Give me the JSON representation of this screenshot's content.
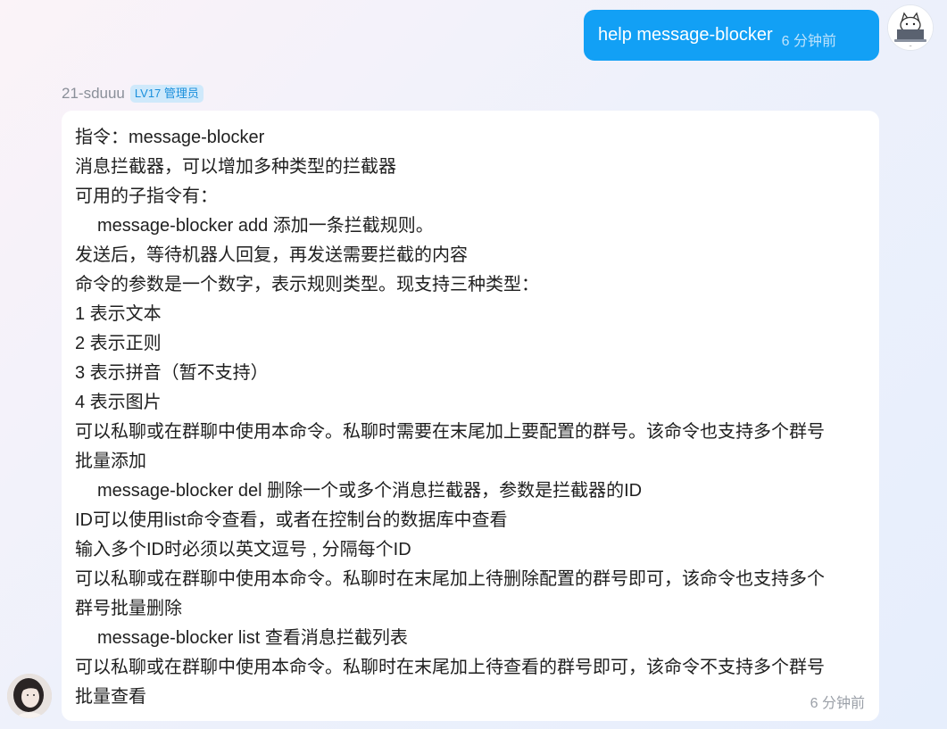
{
  "outgoing": {
    "text": "help message-blocker",
    "time": "6 分钟前"
  },
  "incoming": {
    "sender": "21-sduuu",
    "badge": "LV17 管理员",
    "time": "6 分钟前",
    "lines": [
      {
        "text": "指令：message-blocker",
        "indent": false
      },
      {
        "text": "消息拦截器，可以增加多种类型的拦截器",
        "indent": false
      },
      {
        "text": "可用的子指令有：",
        "indent": false
      },
      {
        "text": "message-blocker add  添加一条拦截规则。",
        "indent": true
      },
      {
        "text": "发送后，等待机器人回复，再发送需要拦截的内容",
        "indent": false
      },
      {
        "text": "命令的参数是一个数字，表示规则类型。现支持三种类型：",
        "indent": false
      },
      {
        "text": "1 表示文本",
        "indent": false
      },
      {
        "text": "2 表示正则",
        "indent": false
      },
      {
        "text": "3 表示拼音（暂不支持）",
        "indent": false
      },
      {
        "text": "4 表示图片",
        "indent": false
      },
      {
        "text": "可以私聊或在群聊中使用本命令。私聊时需要在末尾加上要配置的群号。该命令也支持多个群号",
        "indent": false
      },
      {
        "text": "批量添加",
        "indent": false
      },
      {
        "text": "message-blocker del  删除一个或多个消息拦截器，参数是拦截器的ID",
        "indent": true
      },
      {
        "text": "ID可以使用list命令查看，或者在控制台的数据库中查看",
        "indent": false
      },
      {
        "text": "输入多个ID时必须以英文逗号 , 分隔每个ID",
        "indent": false
      },
      {
        "text": "可以私聊或在群聊中使用本命令。私聊时在末尾加上待删除配置的群号即可，该命令也支持多个",
        "indent": false
      },
      {
        "text": "群号批量删除",
        "indent": false
      },
      {
        "text": "message-blocker list  查看消息拦截列表",
        "indent": true
      },
      {
        "text": "可以私聊或在群聊中使用本命令。私聊时在末尾加上待查看的群号即可，该命令不支持多个群号",
        "indent": false
      },
      {
        "text": "批量查看",
        "indent": false
      }
    ]
  },
  "colors": {
    "outgoing_bubble": "#12a0f5",
    "badge_bg": "#cfe9fb",
    "badge_text": "#1a8fdc"
  },
  "icons": {
    "outgoing_avatar": "cartoon-cat-laptop-avatar",
    "incoming_avatar": "user-photo-avatar"
  }
}
